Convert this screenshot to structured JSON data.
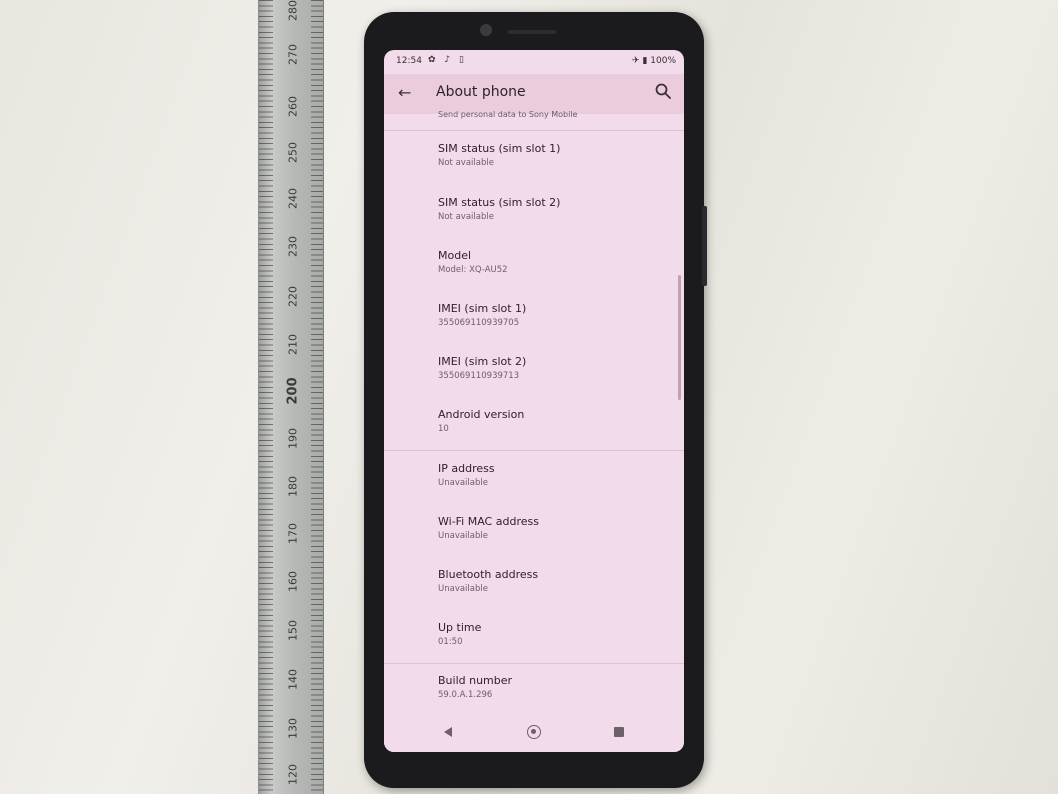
{
  "ruler": {
    "labels": [
      "280",
      "270",
      "260",
      "250",
      "240",
      "230",
      "220",
      "210",
      "200",
      "190",
      "180",
      "170",
      "160",
      "150",
      "140",
      "130",
      "120"
    ]
  },
  "status_bar": {
    "time": "12:54",
    "left_icons": [
      "gear-icon",
      "music-note-icon",
      "vibrate-icon"
    ],
    "left_icons_text": "✿ ♪ ▯",
    "airplane_icon": "airplane-icon",
    "battery_icon": "battery-icon",
    "battery": "100%",
    "right_text": "✈ ▮ 100%"
  },
  "app_bar": {
    "back_glyph": "←",
    "title": "About phone",
    "search_icon": "search-icon"
  },
  "partial_item": "Send personal data to Sony Mobile",
  "items": [
    {
      "title": "SIM status (sim slot 1)",
      "subtitle": "Not available"
    },
    {
      "title": "SIM status (sim slot 2)",
      "subtitle": "Not available"
    },
    {
      "title": "Model",
      "subtitle": "Model: XQ-AU52"
    },
    {
      "title": "IMEI (sim slot 1)",
      "subtitle": "355069110939705"
    },
    {
      "title": "IMEI (sim slot 2)",
      "subtitle": "355069110939713"
    },
    {
      "title": "Android version",
      "subtitle": "10"
    },
    {
      "title": "IP address",
      "subtitle": "Unavailable"
    },
    {
      "title": "Wi-Fi MAC address",
      "subtitle": "Unavailable"
    },
    {
      "title": "Bluetooth address",
      "subtitle": "Unavailable"
    },
    {
      "title": "Up time",
      "subtitle": "01:50"
    },
    {
      "title": "Build number",
      "subtitle": "59.0.A.1.296"
    }
  ],
  "nav_bar": {
    "back_icon": "nav-back-icon",
    "home_icon": "nav-home-icon",
    "recents_icon": "nav-recents-icon"
  },
  "colors": {
    "screen_bg": "#f2dbea",
    "app_bar_bg": "#ebccdc",
    "phone_body": "#1b1b1d"
  }
}
